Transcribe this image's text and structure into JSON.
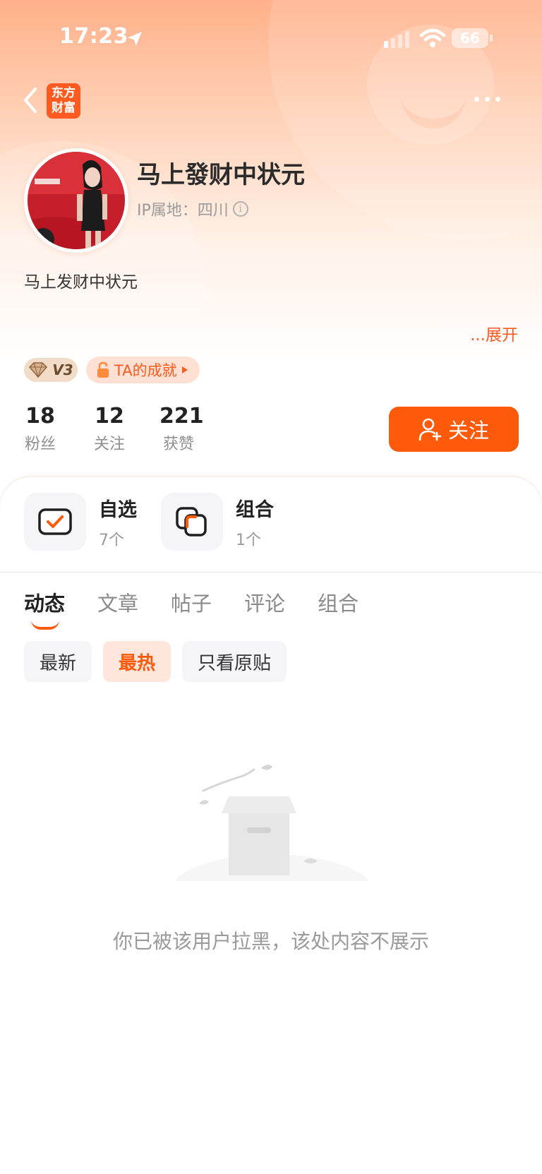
{
  "status_bar": {
    "time": "17:23",
    "battery": "66"
  },
  "nav": {
    "logo_line1": "东方",
    "logo_line2": "财富"
  },
  "profile": {
    "username": "马上發财中状元",
    "ip_label": "IP属地：四川",
    "bio": "马上发财中状元",
    "expand": "...展开",
    "vip_level": "V3",
    "achievement": "TA的成就"
  },
  "stats": [
    {
      "value": "18",
      "label": "粉丝"
    },
    {
      "value": "12",
      "label": "关注"
    },
    {
      "value": "221",
      "label": "获赞"
    }
  ],
  "follow_button": "关注",
  "quick": [
    {
      "title": "自选",
      "sub": "7个"
    },
    {
      "title": "组合",
      "sub": "1个"
    }
  ],
  "tabs": [
    "动态",
    "文章",
    "帖子",
    "评论",
    "组合"
  ],
  "filters": [
    "最新",
    "最热",
    "只看原贴"
  ],
  "empty_message": "你已被该用户拉黑，该处内容不展示",
  "colors": {
    "accent": "#ff5a0a",
    "header_top": "#ffb089"
  }
}
